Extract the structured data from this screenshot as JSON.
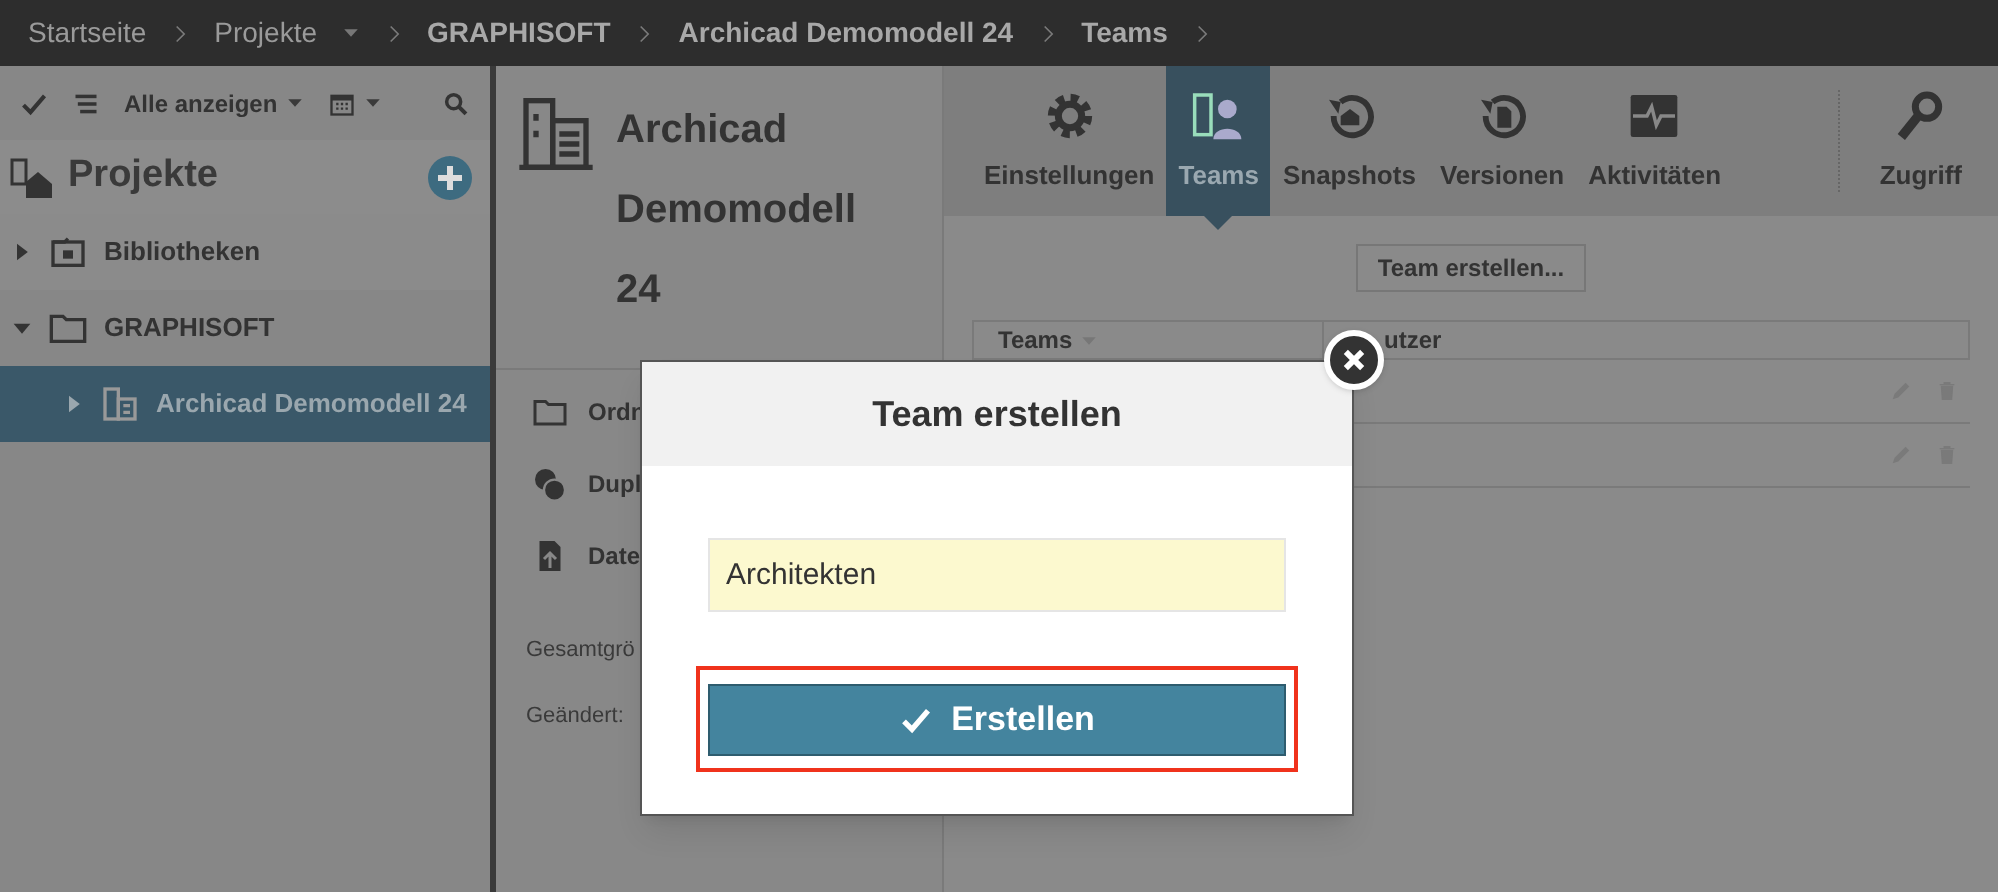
{
  "breadcrumbs": [
    {
      "label": "Startseite",
      "emphasized": false,
      "dropdown": false
    },
    {
      "label": "Projekte",
      "emphasized": false,
      "dropdown": true
    },
    {
      "label": "GRAPHISOFT",
      "emphasized": true,
      "dropdown": false
    },
    {
      "label": "Archicad Demomodell 24",
      "emphasized": true,
      "dropdown": false
    },
    {
      "label": "Teams",
      "emphasized": true,
      "dropdown": false
    }
  ],
  "sidebar": {
    "filter": "Alle anzeigen",
    "title": "Projekte",
    "tree": [
      {
        "label": "Bibliotheken",
        "kind": "library",
        "expanded": false,
        "selected": false
      },
      {
        "label": "GRAPHISOFT",
        "kind": "folder",
        "expanded": true,
        "selected": false,
        "children": [
          {
            "label": "Archicad Demomodell 24",
            "kind": "project",
            "expanded": false,
            "selected": true
          }
        ]
      }
    ]
  },
  "project": {
    "title": "Archicad Demomodell 24",
    "actions": [
      {
        "label": "Ordn",
        "kind": "folder"
      },
      {
        "label": "Dupl",
        "kind": "duplicate"
      },
      {
        "label": "Date",
        "kind": "upload"
      }
    ],
    "details": [
      "Gesamtgrö",
      "Geändert:"
    ]
  },
  "tabs": [
    {
      "label": "Einstellungen",
      "kind": "settings",
      "selected": false
    },
    {
      "label": "Teams",
      "kind": "teams",
      "selected": true
    },
    {
      "label": "Snapshots",
      "kind": "snapshots",
      "selected": false
    },
    {
      "label": "Versionen",
      "kind": "versions",
      "selected": false
    },
    {
      "label": "Aktivitäten",
      "kind": "activity",
      "selected": false
    },
    {
      "label": "Zugriff",
      "kind": "access",
      "selected": false
    }
  ],
  "teams": {
    "create_button": "Team erstellen...",
    "columns": [
      {
        "label": "Teams",
        "sortable": true
      },
      {
        "label": "utzer",
        "sortable": false
      }
    ],
    "rows": [
      {
        "kind": "team"
      },
      {
        "kind": "team"
      }
    ]
  },
  "dialog": {
    "title": "Team erstellen",
    "name_field": {
      "value": "Architekten"
    },
    "submit": {
      "label": "Erstellen",
      "highlighted": true
    }
  }
}
